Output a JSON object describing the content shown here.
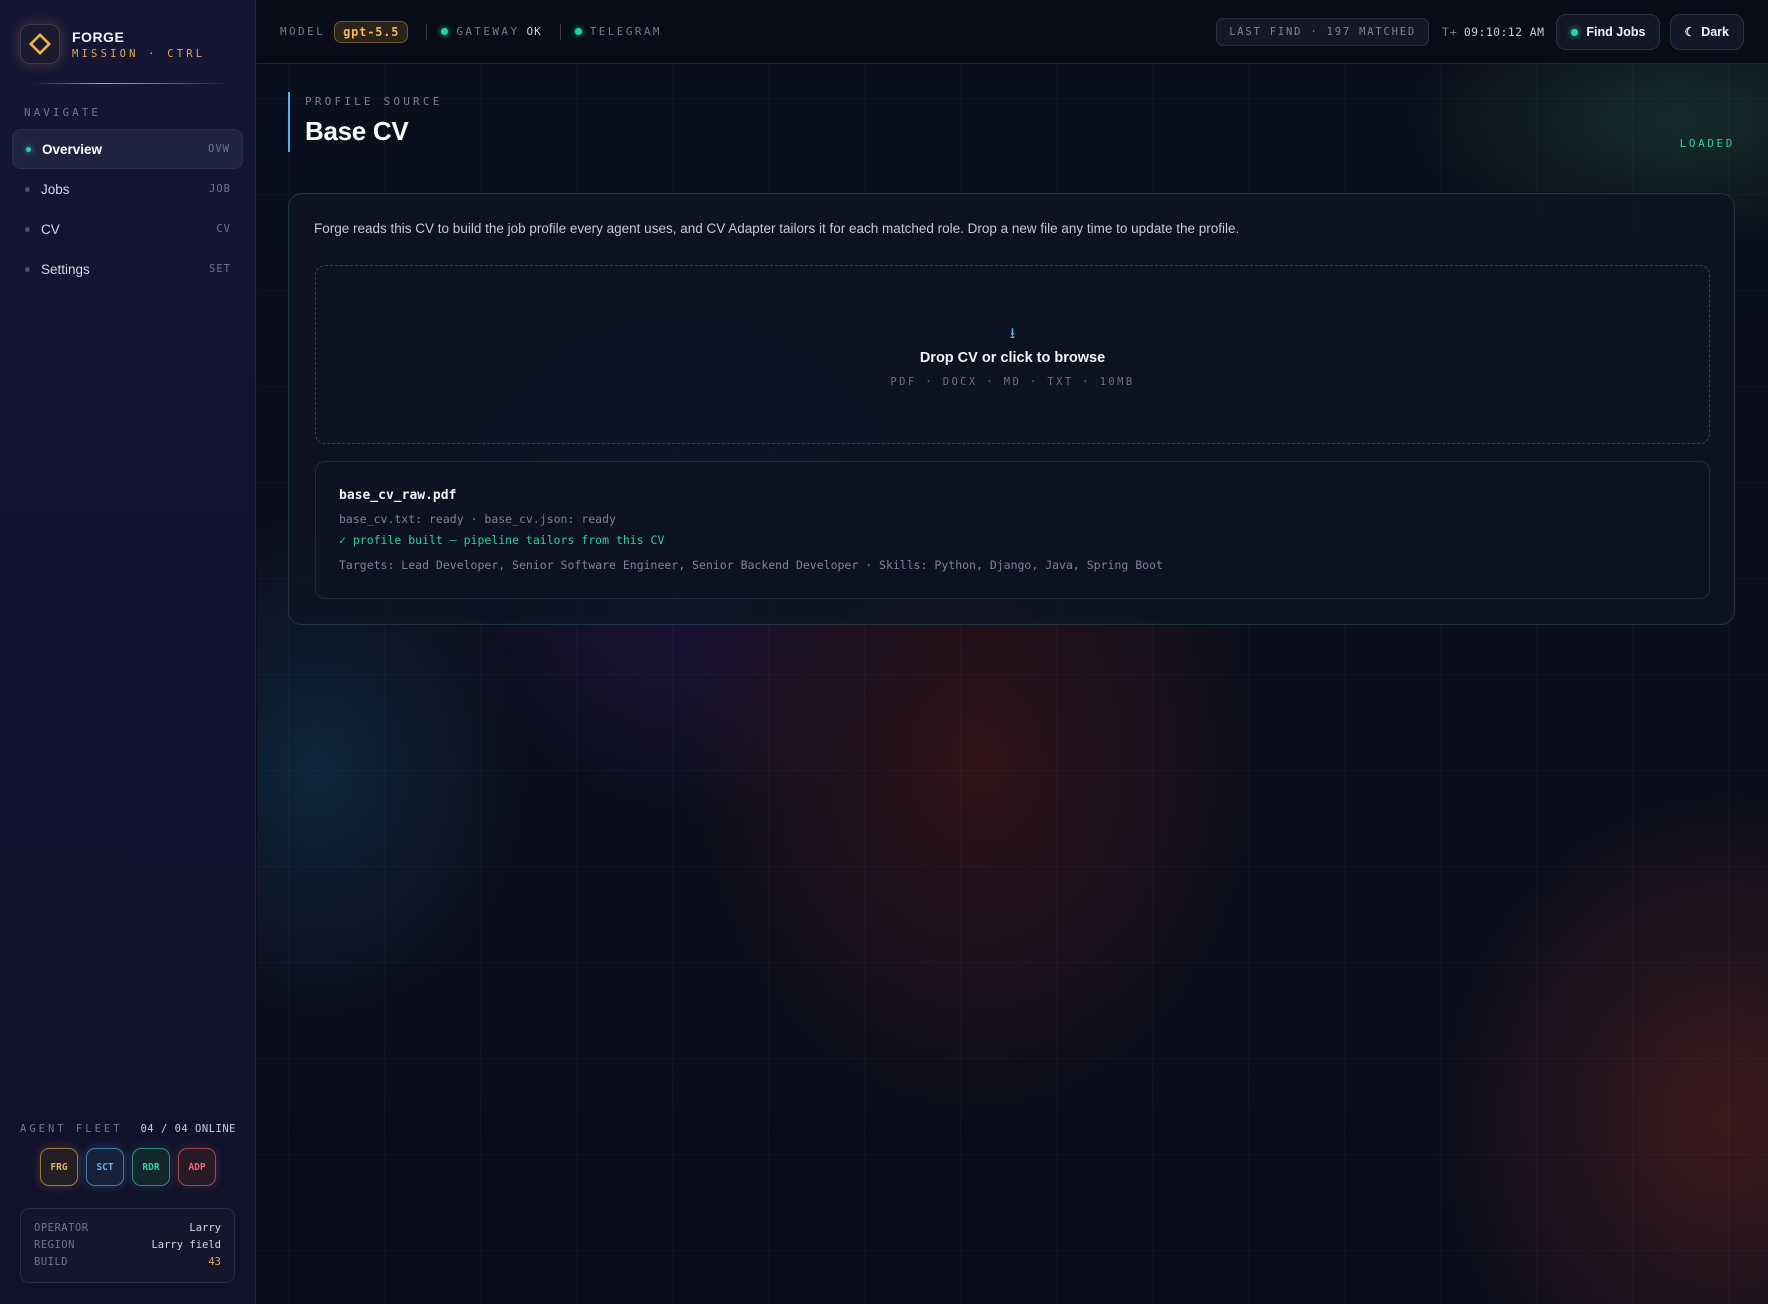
{
  "brand": {
    "name": "FORGE",
    "subtitle": "MISSION · CTRL"
  },
  "nav": {
    "heading": "NAVIGATE",
    "items": [
      {
        "label": "Overview",
        "code": "OVW",
        "active": true
      },
      {
        "label": "Jobs",
        "code": "JOB"
      },
      {
        "label": "CV",
        "code": "CV"
      },
      {
        "label": "Settings",
        "code": "SET"
      }
    ]
  },
  "fleet": {
    "title": "AGENT FLEET",
    "count": "04 / 04 ONLINE",
    "agents": [
      "FRG",
      "SCT",
      "RDR",
      "ADP"
    ]
  },
  "info": {
    "operator_key": "OPERATOR",
    "operator_val": "Larry",
    "region_key": "REGION",
    "region_val": "Larry field",
    "build_key": "BUILD",
    "build_val": "43"
  },
  "topbar": {
    "model_label": "MODEL",
    "model_value": "gpt-5.5",
    "gateway_label": "GATEWAY",
    "gateway_status": "OK",
    "telegram_label": "TELEGRAM",
    "last_find": "LAST FIND · 197 MATCHED",
    "clock_prefix": "T+",
    "clock": "09:10:12 AM",
    "find_jobs": "Find Jobs",
    "theme": "Dark"
  },
  "page": {
    "eyebrow": "PROFILE SOURCE",
    "title": "Base CV",
    "state": "LOADED"
  },
  "card": {
    "description": "Forge reads this CV to build the job profile every agent uses, and CV Adapter tailors it for each matched role. Drop a new file any time to update the profile.",
    "drop_icon": "download-arrow-icon",
    "drop_title": "Drop CV or click to browse",
    "drop_formats": "PDF · DOCX · MD · TXT · 10MB",
    "file_name": "base_cv_raw.pdf",
    "file_status": "base_cv.txt: ready · base_cv.json: ready",
    "file_built": "✓ profile built — pipeline tailors from this CV",
    "file_targets": "Targets: Lead Developer, Senior Software Engineer, Senior Backend Developer · Skills: Python, Django, Java, Spring Boot"
  },
  "colors": {
    "accent_gold": "#e0a955",
    "accent_green": "#23d4a3",
    "accent_blue": "#4fb7e8",
    "accent_red": "#f06870"
  }
}
